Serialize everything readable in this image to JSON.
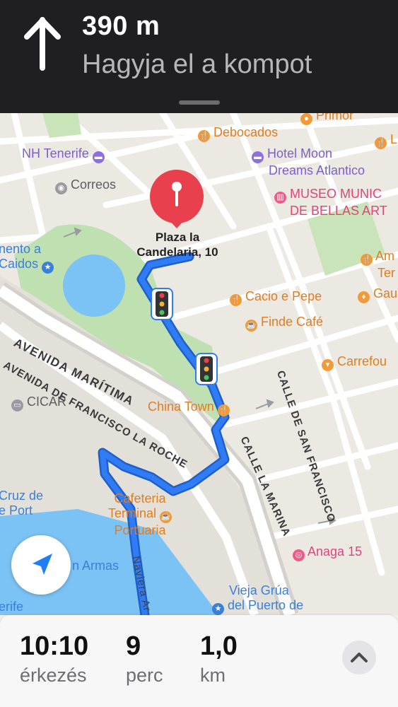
{
  "header": {
    "distance": "390 m",
    "instruction": "Hagyja el a kompot",
    "maneuver_icon": "arrow-up-icon"
  },
  "map": {
    "destination": {
      "label_line1": "Plaza la",
      "label_line2": "Candelaria, 10",
      "icon": "pin-icon",
      "color": "#e8414d"
    },
    "route_color": "#2f7cf6",
    "streets": {
      "avenida_maritima": "AVENIDA MARÍTIMA",
      "avenida_francisco": "AVENIDA DE FRANCISCO LA ROCHE",
      "calle_san_francisco": "CALLE DE SAN FRANCISCO",
      "calle_la_marina": "CALLE LA MARINA",
      "naviera": "Naviera Ar"
    },
    "pois": {
      "primor": "Primor",
      "debocados": "Debocados",
      "l_edge": "L",
      "nh_tenerife": "NH Tenerife",
      "hotel_moon_1": "Hotel Moon",
      "hotel_moon_2": "Dreams Atlantico",
      "correos": "Correos",
      "museo_1": "MUSEO MUNIC",
      "museo_2": "DE BELLAS ART",
      "monumento_1": "nento a",
      "monumento_2": "Caidos",
      "am_1": "Am",
      "am_2": "Ter",
      "cacio": "Cacio e Pepe",
      "gau": "Gau",
      "finde": "Finde Café",
      "carrefour": "Carrefou",
      "cicar": "CICAR",
      "china_town": "China Town",
      "cruz_1": "Cruz de",
      "cruz_2": "e Port",
      "cafeteria_1": "Cafeteria",
      "cafeteria_2": "Terminal",
      "cafeteria_3": "Portuaria",
      "armas": "n Armas",
      "anaga": "Anaga 15",
      "vieja_1": "Vieja Grúa",
      "vieja_2": "del Puerto de",
      "nerife": "erife"
    }
  },
  "trip": {
    "arrival_value": "10:10",
    "arrival_label": "érkezés",
    "minutes_value": "9",
    "minutes_label": "perc",
    "distance_value": "1,0",
    "distance_label": "km"
  },
  "controls": {
    "locate_icon": "location-arrow-icon",
    "expand_icon": "chevron-up-icon"
  }
}
